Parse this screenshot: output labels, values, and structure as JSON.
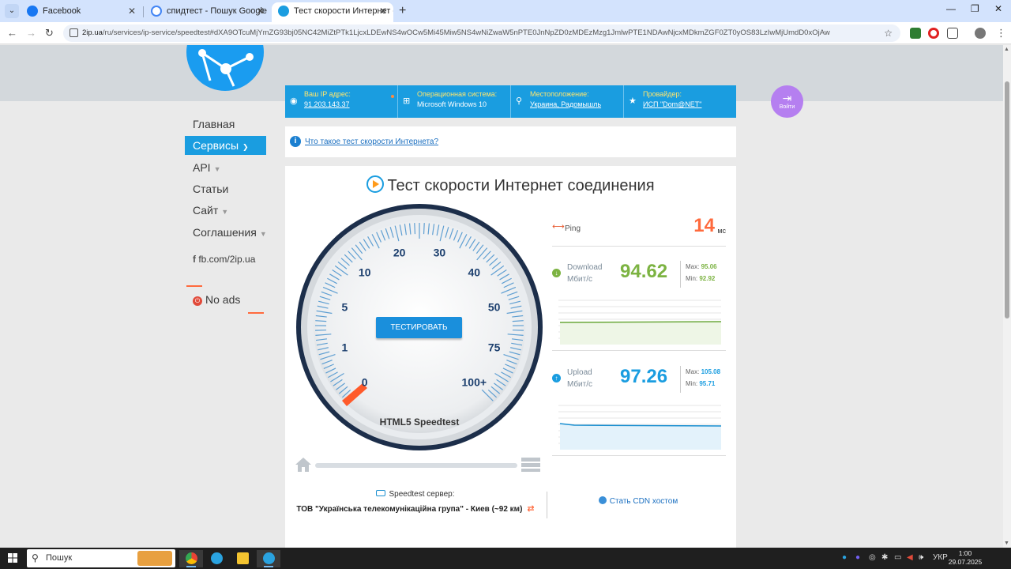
{
  "browser": {
    "tabs": [
      {
        "title": "Facebook"
      },
      {
        "title": "спидтест - Пошук Google"
      },
      {
        "title": "Тест скорости Интернет соеди"
      }
    ],
    "url_host": "2ip.ua",
    "url_path": "/ru/services/ip-service/speedtest#dXA9OTcuMjYmZG93bj05NC42MiZtPTk1LjcxLDEwNS4wOCw5Mi45Miw5NS4wNiZwaW5nPTE0JnNpZD0zMDEzMzg1JmlwPTE1NDAwNjcxMDkmZGF0ZT0yOS83LzIwMjUmdD0xOjAw"
  },
  "info": {
    "ip_label": "Ваш IP адрес:",
    "ip_value": "91.203.143.37",
    "os_label": "Операционная система:",
    "os_value": "Microsoft Windows 10",
    "loc_label": "Местоположение:",
    "loc_value": "Украина, Радомышль",
    "isp_label": "Провайдер:",
    "isp_value": "ИСП \"Dom@NET\""
  },
  "login_label": "Войти",
  "sidebar": {
    "items": [
      {
        "label": "Главная"
      },
      {
        "label": "Сервисы"
      },
      {
        "label": "API"
      },
      {
        "label": "Статьи"
      },
      {
        "label": "Сайт"
      },
      {
        "label": "Соглашения"
      }
    ],
    "fb": "fb.com/2ip.ua",
    "noads": "No ads"
  },
  "question": "Что такое тест скорости Интернета?",
  "panel": {
    "title": "Тест скорости Интернет соединения",
    "test_button": "ТЕСТИРОВАТЬ",
    "gauge_caption": "HTML5 Speedtest",
    "gauge_labels": [
      "0",
      "1",
      "5",
      "10",
      "20",
      "30",
      "40",
      "50",
      "75",
      "100+"
    ]
  },
  "stats": {
    "ping_label": "Ping",
    "ping_value": "14",
    "ping_unit": "мс",
    "download_label": "Download",
    "download_unit": "Мбит/с",
    "download_value": "94.62",
    "download_max_label": "Max:",
    "download_max": "95.06",
    "download_min_label": "Min:",
    "download_min": "92.92",
    "upload_label": "Upload",
    "upload_unit": "Мбит/с",
    "upload_value": "97.26",
    "upload_max_label": "Max:",
    "upload_max": "105.08",
    "upload_min_label": "Min:",
    "upload_min": "95.71"
  },
  "server": {
    "label": "Speedtest сервер:",
    "value": "ТОВ \"Українська телекомунікаційна група\" - Киев (~92 км)",
    "cdn": "Стать CDN хостом"
  },
  "taskbar": {
    "search": "Пошук",
    "lang": "УКР",
    "time": "1:00",
    "date": "29.07.2025"
  },
  "colors": {
    "accent": "#1a9de0",
    "download": "#7cb342",
    "upload": "#1a9de0",
    "ping": "#ff6a3d"
  }
}
